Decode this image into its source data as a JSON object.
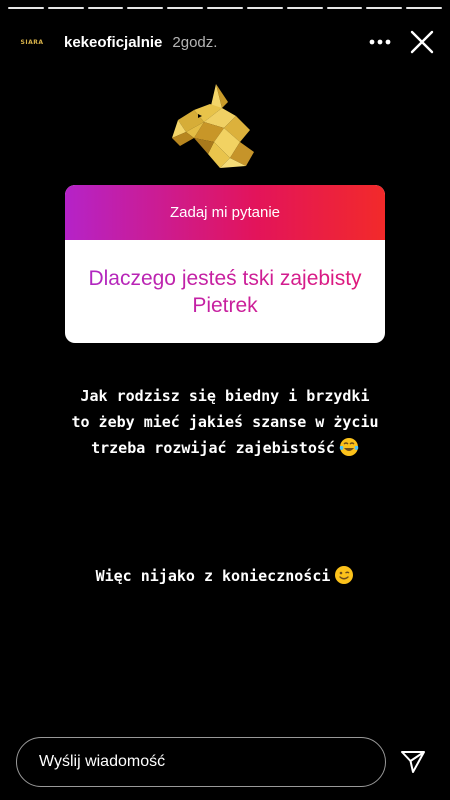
{
  "story": {
    "segments": 11,
    "username": "kekeoficjalnie",
    "time": "2godz.",
    "avatar_text": "SIARA"
  },
  "question_box": {
    "title": "Zadaj mi pytanie",
    "question": "Dlaczego jesteś tski zajebisty Pietrek"
  },
  "texts": {
    "line1": "Jak rodzisz się biedny i brzydki\nto żeby mieć jakieś szanse w życiu\ntrzeba rozwijać zajebistość",
    "line2": "Więc nijako z konieczności"
  },
  "icons": {
    "more": "more-horizontal-icon",
    "close": "close-icon",
    "send": "send-icon",
    "emoji1": "tears-of-joy-emoji",
    "emoji2": "winking-face-emoji"
  },
  "footer": {
    "placeholder": "Wyślij wiadomość"
  },
  "colors": {
    "gradient_start": "#b523c8",
    "gradient_end": "#f22a2a",
    "unicorn_gold": "#e8c34a"
  }
}
